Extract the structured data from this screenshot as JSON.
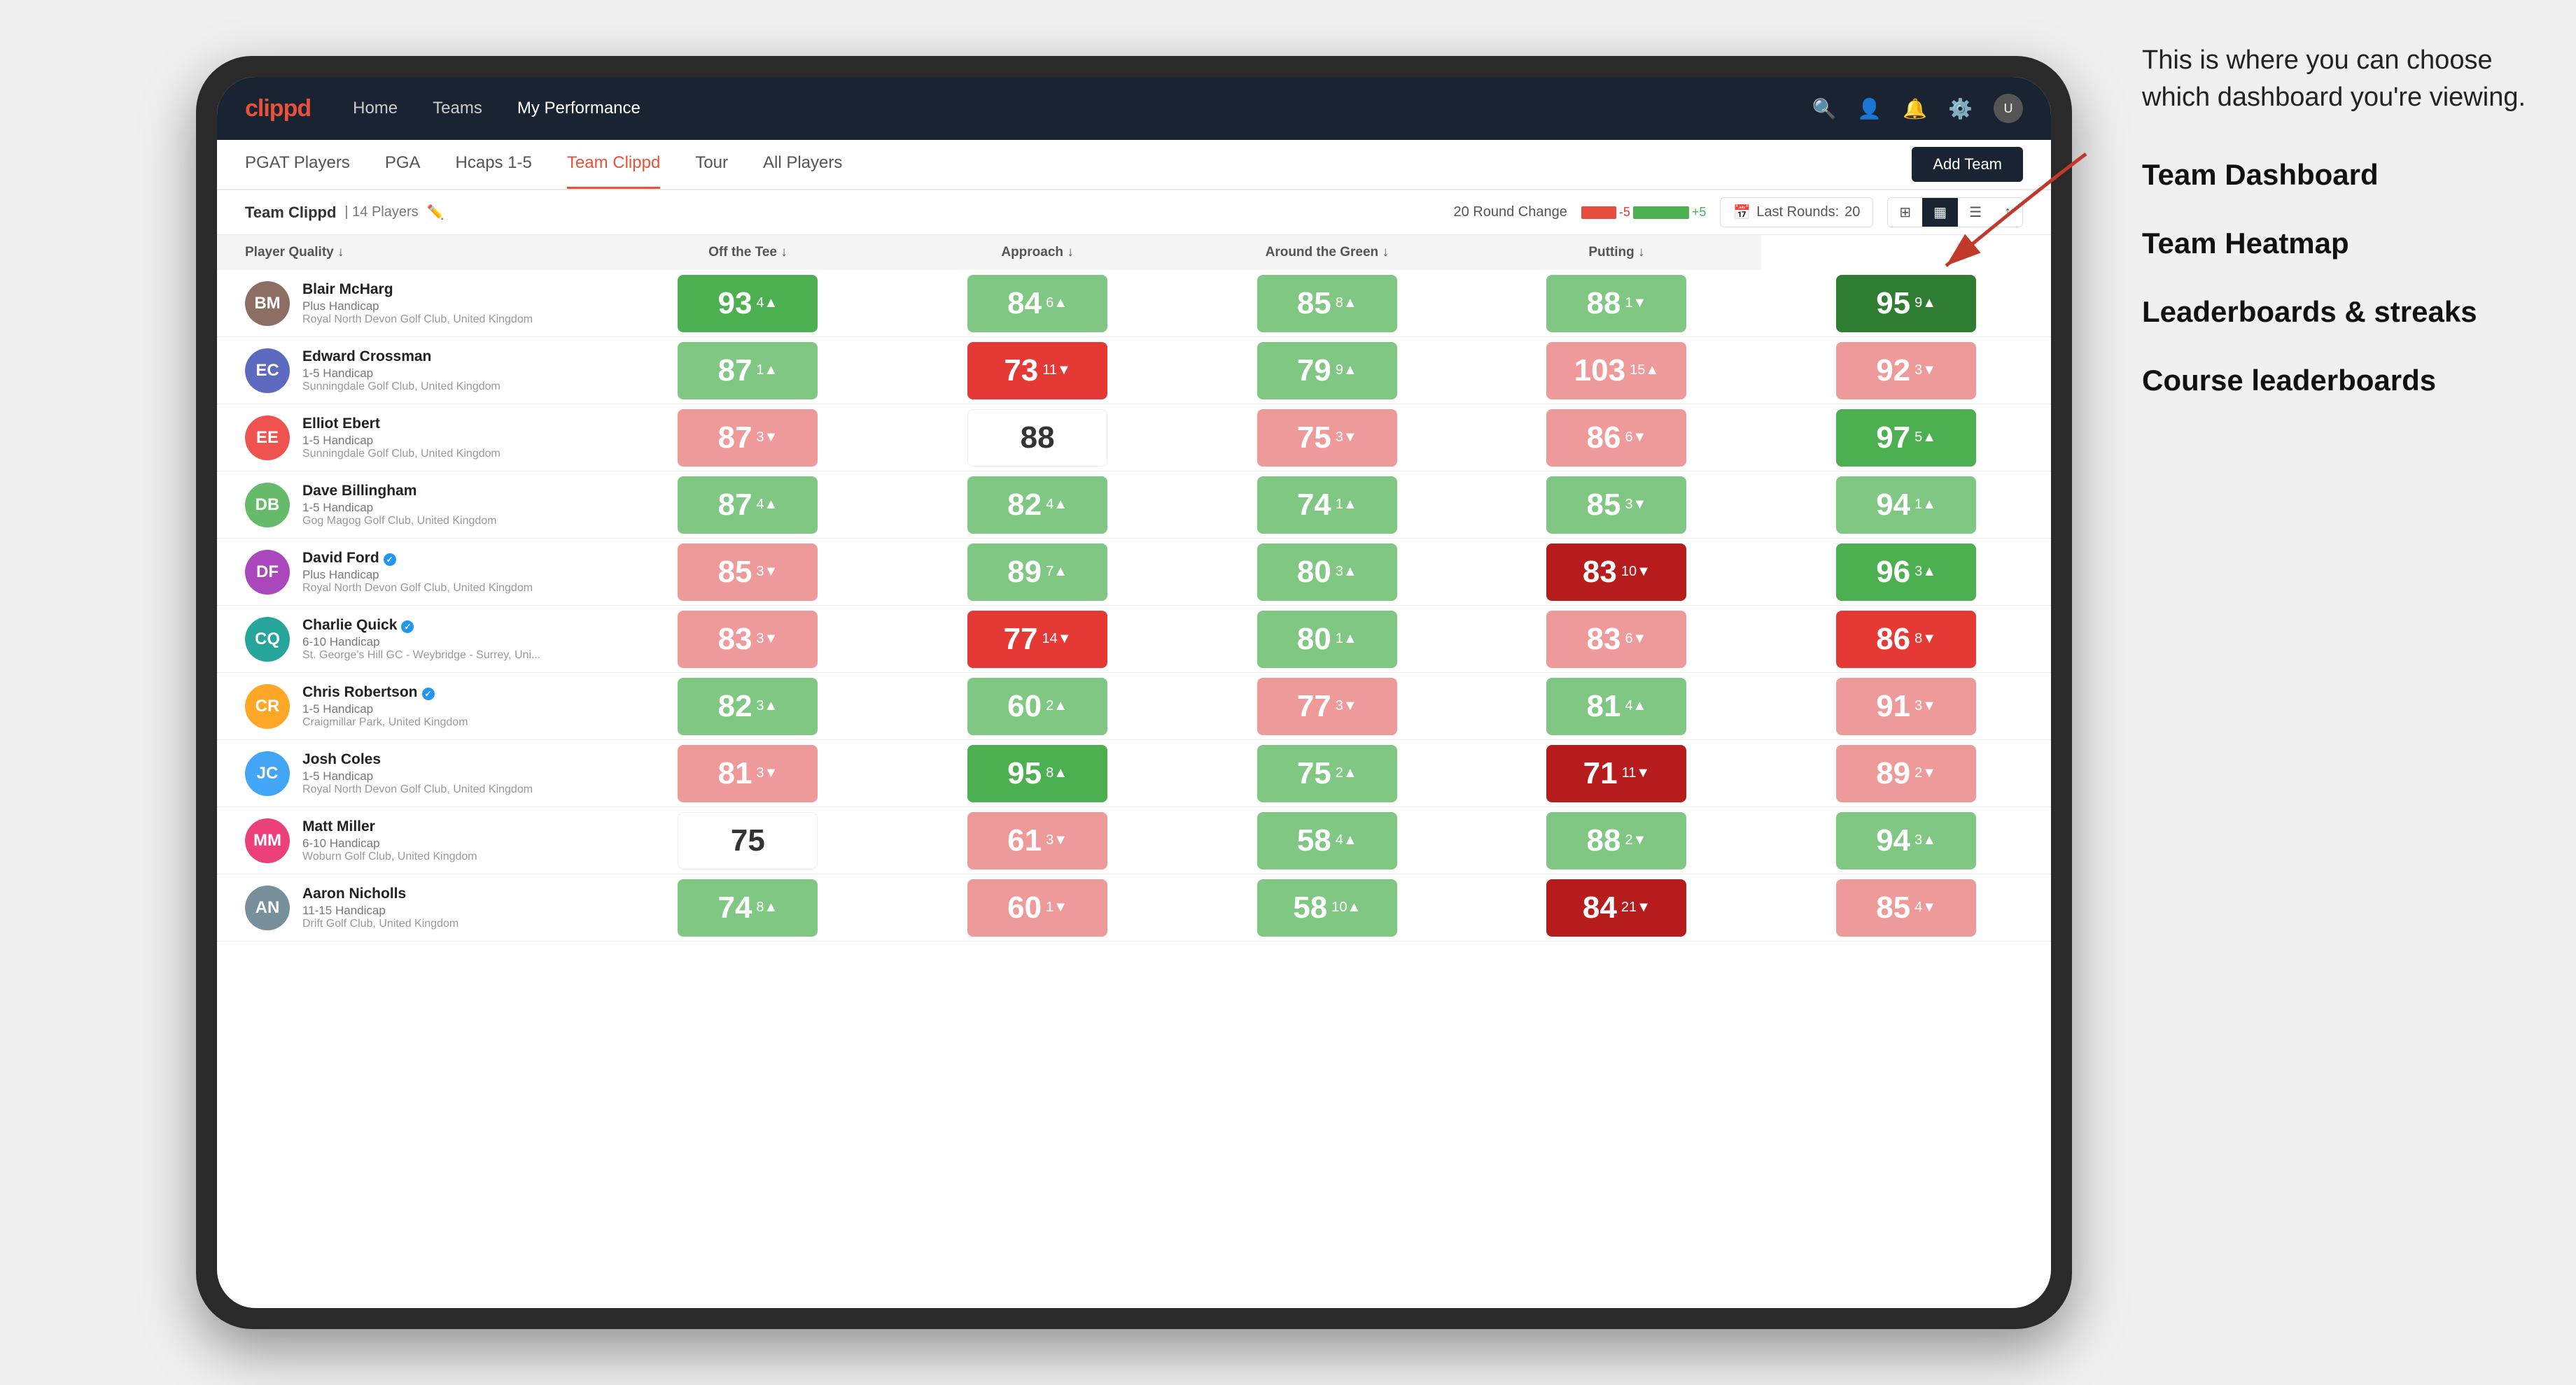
{
  "annotation": {
    "intro": "This is where you can choose which dashboard you're viewing.",
    "items": [
      "Team Dashboard",
      "Team Heatmap",
      "Leaderboards & streaks",
      "Course leaderboards"
    ]
  },
  "nav": {
    "logo": "clippd",
    "links": [
      "Home",
      "Teams",
      "My Performance"
    ],
    "active_link": "My Performance"
  },
  "sub_tabs": [
    "PGAT Players",
    "PGA",
    "Hcaps 1-5",
    "Team Clippd",
    "Tour",
    "All Players"
  ],
  "active_sub_tab": "Team Clippd",
  "add_team_label": "Add Team",
  "team_info": {
    "name": "Team Clippd",
    "player_count": "14 Players",
    "round_change_label": "20 Round Change",
    "neg_value": "-5",
    "pos_value": "+5",
    "last_rounds_label": "Last Rounds:",
    "last_rounds_value": "20"
  },
  "table": {
    "headers": [
      "Player Quality ↓",
      "Off the Tee ↓",
      "Approach ↓",
      "Around the Green ↓",
      "Putting ↓"
    ],
    "players": [
      {
        "name": "Blair McHarg",
        "handicap": "Plus Handicap",
        "club": "Royal North Devon Golf Club, United Kingdom",
        "avatar_initials": "BM",
        "avatar_class": "av-1",
        "scores": [
          {
            "value": "93",
            "delta": "4",
            "dir": "up",
            "color": "green-med"
          },
          {
            "value": "84",
            "delta": "6",
            "dir": "up",
            "color": "green-light"
          },
          {
            "value": "85",
            "delta": "8",
            "dir": "up",
            "color": "green-light"
          },
          {
            "value": "88",
            "delta": "1",
            "dir": "down",
            "color": "green-light"
          },
          {
            "value": "95",
            "delta": "9",
            "dir": "up",
            "color": "green-dark"
          }
        ]
      },
      {
        "name": "Edward Crossman",
        "handicap": "1-5 Handicap",
        "club": "Sunningdale Golf Club, United Kingdom",
        "avatar_initials": "EC",
        "avatar_class": "av-2",
        "scores": [
          {
            "value": "87",
            "delta": "1",
            "dir": "up",
            "color": "green-light"
          },
          {
            "value": "73",
            "delta": "11",
            "dir": "down",
            "color": "red-med"
          },
          {
            "value": "79",
            "delta": "9",
            "dir": "up",
            "color": "green-light"
          },
          {
            "value": "103",
            "delta": "15",
            "dir": "up",
            "color": "red-light"
          },
          {
            "value": "92",
            "delta": "3",
            "dir": "down",
            "color": "red-light"
          }
        ]
      },
      {
        "name": "Elliot Ebert",
        "handicap": "1-5 Handicap",
        "club": "Sunningdale Golf Club, United Kingdom",
        "avatar_initials": "EE",
        "avatar_class": "av-3",
        "scores": [
          {
            "value": "87",
            "delta": "3",
            "dir": "down",
            "color": "red-light"
          },
          {
            "value": "88",
            "delta": "",
            "dir": "none",
            "color": "neutral"
          },
          {
            "value": "75",
            "delta": "3",
            "dir": "down",
            "color": "red-light"
          },
          {
            "value": "86",
            "delta": "6",
            "dir": "down",
            "color": "red-light"
          },
          {
            "value": "97",
            "delta": "5",
            "dir": "up",
            "color": "green-med"
          }
        ]
      },
      {
        "name": "Dave Billingham",
        "handicap": "1-5 Handicap",
        "club": "Gog Magog Golf Club, United Kingdom",
        "avatar_initials": "DB",
        "avatar_class": "av-4",
        "scores": [
          {
            "value": "87",
            "delta": "4",
            "dir": "up",
            "color": "green-light"
          },
          {
            "value": "82",
            "delta": "4",
            "dir": "up",
            "color": "green-light"
          },
          {
            "value": "74",
            "delta": "1",
            "dir": "up",
            "color": "green-light"
          },
          {
            "value": "85",
            "delta": "3",
            "dir": "down",
            "color": "green-light"
          },
          {
            "value": "94",
            "delta": "1",
            "dir": "up",
            "color": "green-light"
          }
        ]
      },
      {
        "name": "David Ford",
        "handicap": "Plus Handicap",
        "club": "Royal North Devon Golf Club, United Kingdom",
        "verified": true,
        "avatar_initials": "DF",
        "avatar_class": "av-5",
        "scores": [
          {
            "value": "85",
            "delta": "3",
            "dir": "down",
            "color": "red-light"
          },
          {
            "value": "89",
            "delta": "7",
            "dir": "up",
            "color": "green-light"
          },
          {
            "value": "80",
            "delta": "3",
            "dir": "up",
            "color": "green-light"
          },
          {
            "value": "83",
            "delta": "10",
            "dir": "down",
            "color": "red-dark"
          },
          {
            "value": "96",
            "delta": "3",
            "dir": "up",
            "color": "green-med"
          }
        ]
      },
      {
        "name": "Charlie Quick",
        "handicap": "6-10 Handicap",
        "club": "St. George's Hill GC - Weybridge - Surrey, Uni...",
        "verified": true,
        "avatar_initials": "CQ",
        "avatar_class": "av-6",
        "scores": [
          {
            "value": "83",
            "delta": "3",
            "dir": "down",
            "color": "red-light"
          },
          {
            "value": "77",
            "delta": "14",
            "dir": "down",
            "color": "red-med"
          },
          {
            "value": "80",
            "delta": "1",
            "dir": "up",
            "color": "green-light"
          },
          {
            "value": "83",
            "delta": "6",
            "dir": "down",
            "color": "red-light"
          },
          {
            "value": "86",
            "delta": "8",
            "dir": "down",
            "color": "red-med"
          }
        ]
      },
      {
        "name": "Chris Robertson",
        "handicap": "1-5 Handicap",
        "club": "Craigmillar Park, United Kingdom",
        "verified": true,
        "avatar_initials": "CR",
        "avatar_class": "av-7",
        "scores": [
          {
            "value": "82",
            "delta": "3",
            "dir": "up",
            "color": "green-light"
          },
          {
            "value": "60",
            "delta": "2",
            "dir": "up",
            "color": "green-light"
          },
          {
            "value": "77",
            "delta": "3",
            "dir": "down",
            "color": "red-light"
          },
          {
            "value": "81",
            "delta": "4",
            "dir": "up",
            "color": "green-light"
          },
          {
            "value": "91",
            "delta": "3",
            "dir": "down",
            "color": "red-light"
          }
        ]
      },
      {
        "name": "Josh Coles",
        "handicap": "1-5 Handicap",
        "club": "Royal North Devon Golf Club, United Kingdom",
        "avatar_initials": "JC",
        "avatar_class": "av-8",
        "scores": [
          {
            "value": "81",
            "delta": "3",
            "dir": "down",
            "color": "red-light"
          },
          {
            "value": "95",
            "delta": "8",
            "dir": "up",
            "color": "green-med"
          },
          {
            "value": "75",
            "delta": "2",
            "dir": "up",
            "color": "green-light"
          },
          {
            "value": "71",
            "delta": "11",
            "dir": "down",
            "color": "red-dark"
          },
          {
            "value": "89",
            "delta": "2",
            "dir": "down",
            "color": "red-light"
          }
        ]
      },
      {
        "name": "Matt Miller",
        "handicap": "6-10 Handicap",
        "club": "Woburn Golf Club, United Kingdom",
        "avatar_initials": "MM",
        "avatar_class": "av-9",
        "scores": [
          {
            "value": "75",
            "delta": "",
            "dir": "none",
            "color": "neutral"
          },
          {
            "value": "61",
            "delta": "3",
            "dir": "down",
            "color": "red-light"
          },
          {
            "value": "58",
            "delta": "4",
            "dir": "up",
            "color": "green-light"
          },
          {
            "value": "88",
            "delta": "2",
            "dir": "down",
            "color": "green-light"
          },
          {
            "value": "94",
            "delta": "3",
            "dir": "up",
            "color": "green-light"
          }
        ]
      },
      {
        "name": "Aaron Nicholls",
        "handicap": "11-15 Handicap",
        "club": "Drift Golf Club, United Kingdom",
        "avatar_initials": "AN",
        "avatar_class": "av-10",
        "scores": [
          {
            "value": "74",
            "delta": "8",
            "dir": "up",
            "color": "green-light"
          },
          {
            "value": "60",
            "delta": "1",
            "dir": "down",
            "color": "red-light"
          },
          {
            "value": "58",
            "delta": "10",
            "dir": "up",
            "color": "green-light"
          },
          {
            "value": "84",
            "delta": "21",
            "dir": "down",
            "color": "red-dark"
          },
          {
            "value": "85",
            "delta": "4",
            "dir": "down",
            "color": "red-light"
          }
        ]
      }
    ]
  }
}
